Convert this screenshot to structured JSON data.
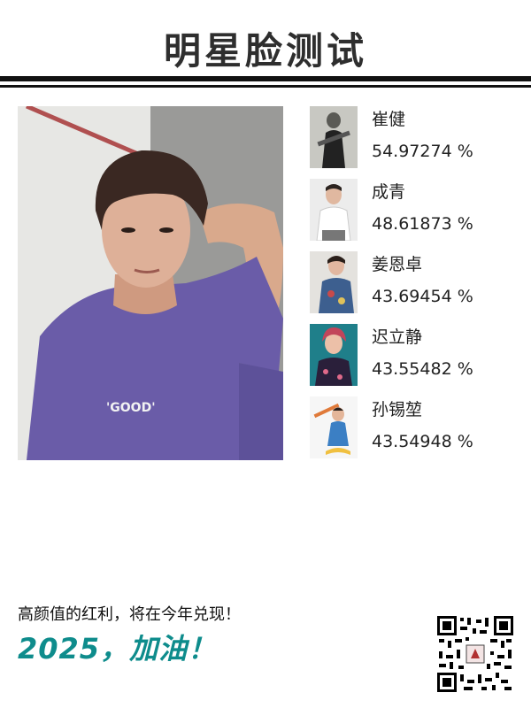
{
  "header": {
    "title": "明星脸测试"
  },
  "matches": [
    {
      "name": "崔健",
      "score": "54.97274 %"
    },
    {
      "name": "成青",
      "score": "48.61873 %"
    },
    {
      "name": "姜恩卓",
      "score": "43.69454 %"
    },
    {
      "name": "迟立静",
      "score": "43.55482 %"
    },
    {
      "name": "孙锡堃",
      "score": "43.54948 %"
    }
  ],
  "photo_text": "'GOOD'",
  "footer": {
    "slogan": "高颜值的红利，将在今年兑现！",
    "cheer": "2025，加油！"
  },
  "colors": {
    "accent": "#0e8c8c",
    "title": "#2e2e2e",
    "rule": "#111111"
  }
}
